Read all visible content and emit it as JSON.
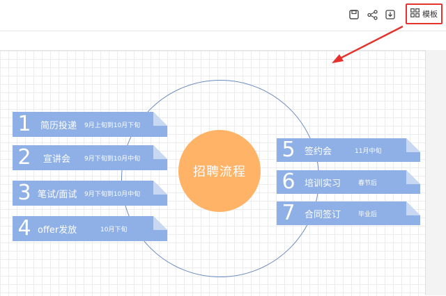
{
  "toolbar": {
    "icons": [
      "save-icon",
      "share-icon",
      "download-icon",
      "template-grid-icon"
    ],
    "template_label": "模板"
  },
  "mindmap": {
    "center": "招聘流程",
    "left_items": [
      {
        "num": "1",
        "label": "简历投递",
        "date": "9月上旬到10月下旬"
      },
      {
        "num": "2",
        "label": "宣讲会",
        "date": "9月下旬到10月中旬"
      },
      {
        "num": "3",
        "label": "笔试/面试",
        "date": "9月下旬到10月中旬"
      },
      {
        "num": "4",
        "label": "offer发放",
        "date": "10月下旬"
      }
    ],
    "right_items": [
      {
        "num": "5",
        "label": "签约会",
        "date": "11月中旬"
      },
      {
        "num": "6",
        "label": "培训实习",
        "date": "春节后"
      },
      {
        "num": "7",
        "label": "合同签订",
        "date": "毕业后"
      }
    ]
  },
  "colors": {
    "center": "#ffb366",
    "item": "#8fb0e6",
    "ring": "#6a8bbf",
    "highlight": "#e5322d"
  }
}
